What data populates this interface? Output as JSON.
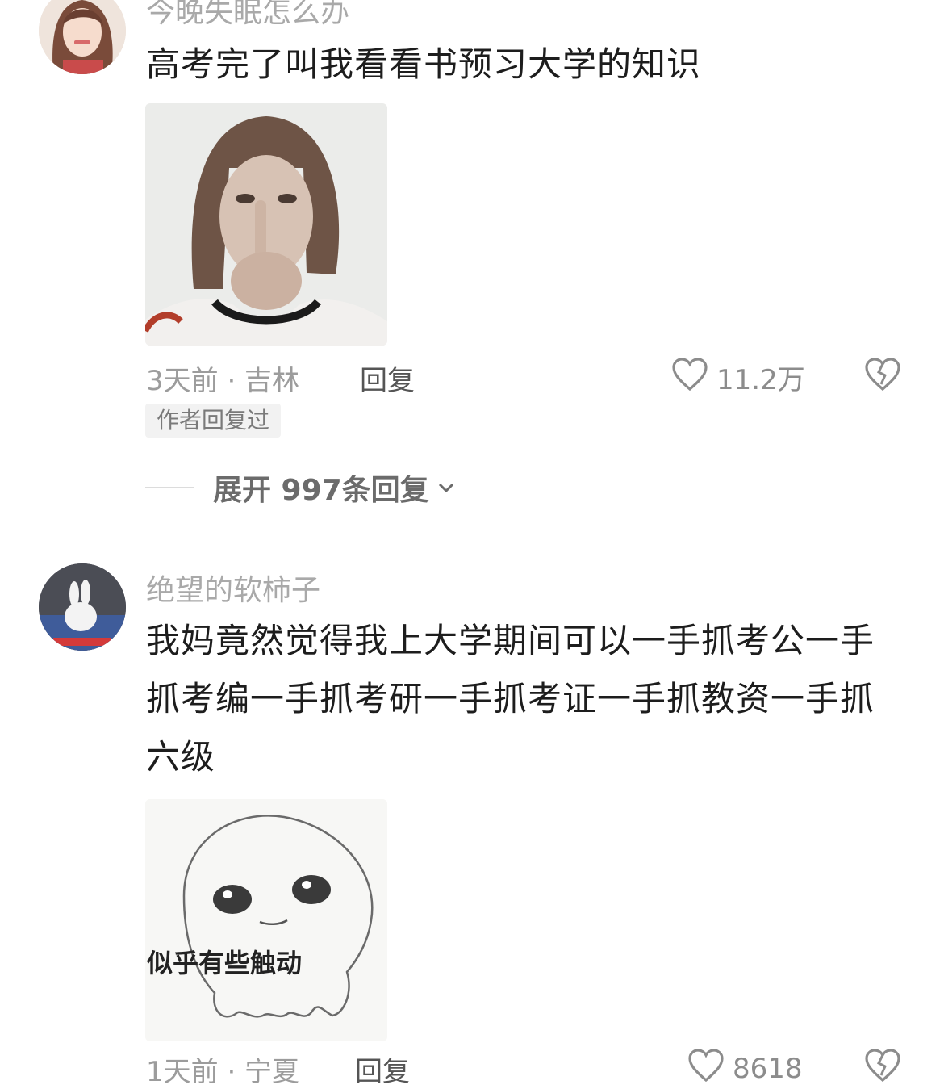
{
  "comments": [
    {
      "username": "今晚失眠怎么办",
      "text": "高考完了叫我看看书预习大学的知识",
      "meta": "3天前 · 吉林",
      "reply_label": "回复",
      "likes": "11.2万",
      "author_badge": "作者回复过",
      "expand_label": "展开 997条回复"
    },
    {
      "username": "绝望的软柿子",
      "text": "我妈竟然觉得我上大学期间可以一手抓考公一手抓考编一手抓考研一手抓考证一手抓教资一手抓六级",
      "meme_caption": "似乎有些触动",
      "meta": "1天前 · 宁夏",
      "reply_label": "回复",
      "likes": "8618"
    }
  ],
  "icons": {
    "like": "heart-outline-icon",
    "dislike": "broken-heart-icon",
    "expand": "chevron-down-icon"
  },
  "colors": {
    "username": "#a9a9a9",
    "text": "#1d1d1d",
    "meta": "#9c9c9c",
    "badge_bg": "#f2f2f2"
  }
}
